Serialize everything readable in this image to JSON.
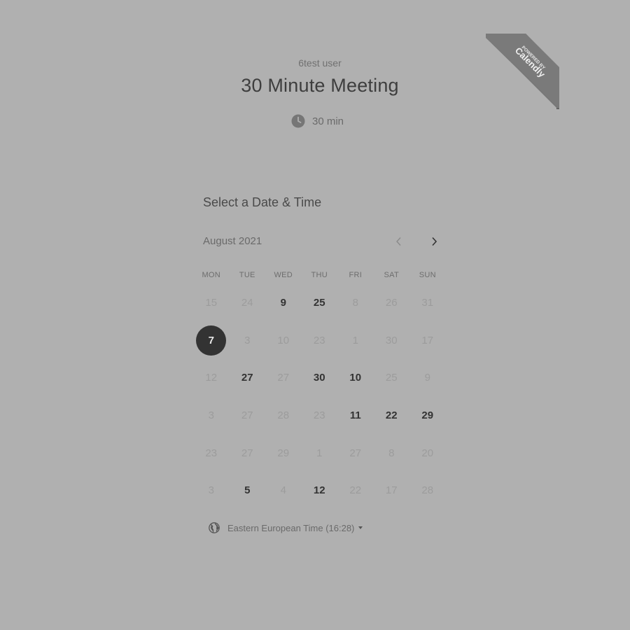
{
  "header": {
    "owner_name": "6test user",
    "event_title": "30 Minute Meeting",
    "duration": "30 min",
    "duration_icon": "clock-icon"
  },
  "ribbon": {
    "line1": "POWERED BY",
    "line2": "Calendly"
  },
  "calendar": {
    "section_title": "Select a Date & Time",
    "month_label": "August 2021",
    "prev_icon": "chevron-left-icon",
    "next_icon": "chevron-right-icon",
    "weekdays": [
      "MON",
      "TUE",
      "WED",
      "THU",
      "FRI",
      "SAT",
      "SUN"
    ],
    "weeks": [
      [
        {
          "label": "15",
          "state": "unavailable"
        },
        {
          "label": "24",
          "state": "unavailable"
        },
        {
          "label": "9",
          "state": "available"
        },
        {
          "label": "25",
          "state": "available"
        },
        {
          "label": "8",
          "state": "unavailable"
        },
        {
          "label": "26",
          "state": "unavailable"
        },
        {
          "label": "31",
          "state": "unavailable"
        }
      ],
      [
        {
          "label": "7",
          "state": "selected"
        },
        {
          "label": "3",
          "state": "unavailable"
        },
        {
          "label": "10",
          "state": "unavailable"
        },
        {
          "label": "23",
          "state": "unavailable"
        },
        {
          "label": "1",
          "state": "unavailable"
        },
        {
          "label": "30",
          "state": "unavailable"
        },
        {
          "label": "17",
          "state": "unavailable"
        }
      ],
      [
        {
          "label": "12",
          "state": "unavailable"
        },
        {
          "label": "27",
          "state": "available"
        },
        {
          "label": "27",
          "state": "unavailable"
        },
        {
          "label": "30",
          "state": "available"
        },
        {
          "label": "10",
          "state": "available"
        },
        {
          "label": "25",
          "state": "unavailable"
        },
        {
          "label": "9",
          "state": "unavailable"
        }
      ],
      [
        {
          "label": "3",
          "state": "unavailable"
        },
        {
          "label": "27",
          "state": "unavailable"
        },
        {
          "label": "28",
          "state": "unavailable"
        },
        {
          "label": "23",
          "state": "unavailable"
        },
        {
          "label": "11",
          "state": "available"
        },
        {
          "label": "22",
          "state": "available"
        },
        {
          "label": "29",
          "state": "available"
        }
      ],
      [
        {
          "label": "23",
          "state": "unavailable"
        },
        {
          "label": "27",
          "state": "unavailable"
        },
        {
          "label": "29",
          "state": "unavailable"
        },
        {
          "label": "1",
          "state": "unavailable"
        },
        {
          "label": "27",
          "state": "unavailable"
        },
        {
          "label": "8",
          "state": "unavailable"
        },
        {
          "label": "20",
          "state": "unavailable"
        }
      ],
      [
        {
          "label": "3",
          "state": "unavailable"
        },
        {
          "label": "5",
          "state": "available"
        },
        {
          "label": "4",
          "state": "unavailable"
        },
        {
          "label": "12",
          "state": "available"
        },
        {
          "label": "22",
          "state": "unavailable"
        },
        {
          "label": "17",
          "state": "unavailable"
        },
        {
          "label": "28",
          "state": "unavailable"
        }
      ]
    ]
  },
  "timezone": {
    "label": "Eastern European Time (16:28)",
    "icon": "globe-icon",
    "caret_icon": "caret-down-icon"
  },
  "colors": {
    "background": "#b0b0b0",
    "selected_day": "#333333",
    "ribbon": "#777777"
  }
}
